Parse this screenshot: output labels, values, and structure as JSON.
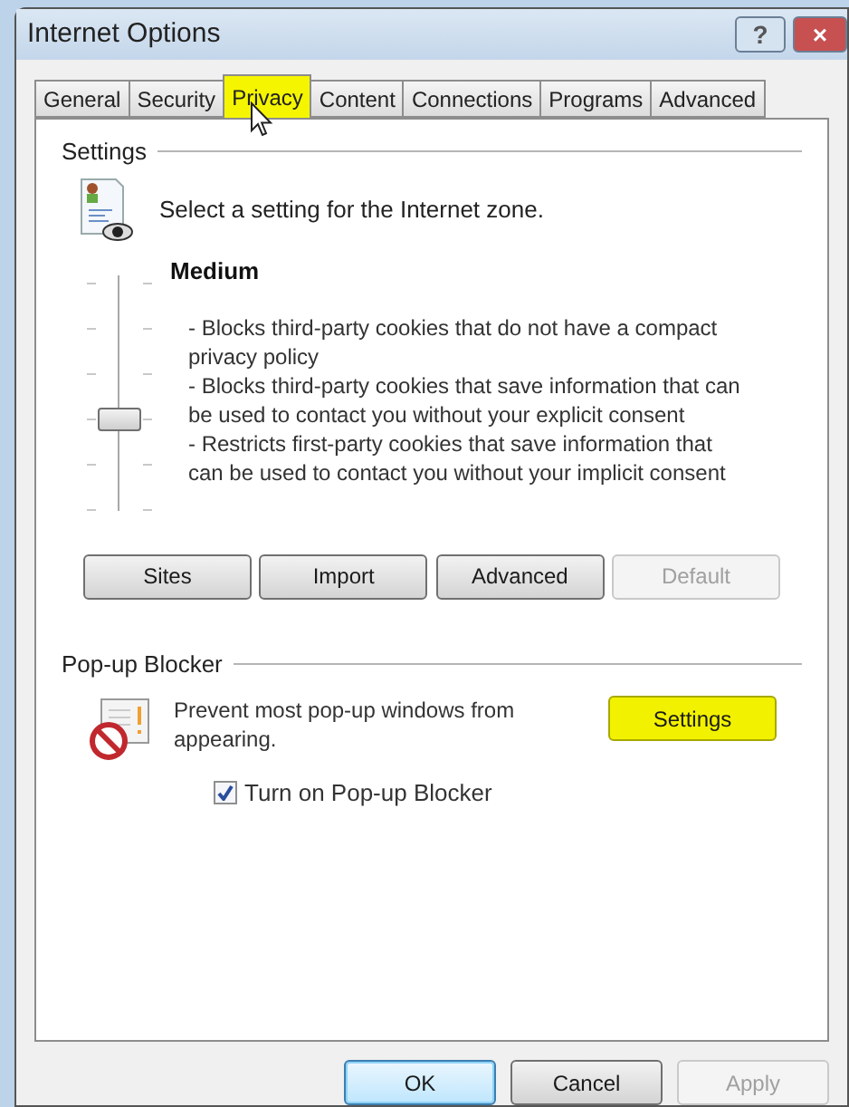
{
  "window": {
    "title": "Internet Options",
    "controls": [
      {
        "kind": "help",
        "label": "?"
      },
      {
        "kind": "close",
        "label": "×"
      }
    ]
  },
  "tabs": [
    {
      "label": "General",
      "selected": false,
      "highlighted": false
    },
    {
      "label": "Security",
      "selected": false,
      "highlighted": false
    },
    {
      "label": "Privacy",
      "selected": true,
      "highlighted": true
    },
    {
      "label": "Content",
      "selected": false,
      "highlighted": false
    },
    {
      "label": "Connections",
      "selected": false,
      "highlighted": false
    },
    {
      "label": "Programs",
      "selected": false,
      "highlighted": false
    },
    {
      "label": "Advanced",
      "selected": false,
      "highlighted": false
    }
  ],
  "settings": {
    "heading": "Settings",
    "intro": "Select a setting for the Internet zone.",
    "slider": {
      "level": 0.4
    },
    "level_name": "Medium",
    "description": [
      "- Blocks third-party cookies that do not have a compact privacy policy",
      "- Blocks third-party cookies that save information that can be used to contact you without your explicit consent",
      "- Restricts first-party cookies that save information that can be used to contact you without your implicit consent"
    ],
    "buttons": [
      {
        "label": "Sites",
        "disabled": false
      },
      {
        "label": "Import",
        "disabled": false
      },
      {
        "label": "Advanced",
        "disabled": false
      },
      {
        "label": "Default",
        "disabled": true
      }
    ]
  },
  "popup_blocker": {
    "heading": "Pop-up Blocker",
    "text": "Prevent most pop-up windows from appearing.",
    "settings_button": {
      "label": "Settings",
      "highlighted": true
    },
    "checkbox": {
      "label": "Turn on Pop-up Blocker",
      "checked": true
    }
  },
  "footer_buttons": [
    {
      "label": "OK",
      "default": true,
      "disabled": false
    },
    {
      "label": "Cancel",
      "default": false,
      "disabled": false
    },
    {
      "label": "Apply",
      "default": false,
      "disabled": true
    }
  ]
}
